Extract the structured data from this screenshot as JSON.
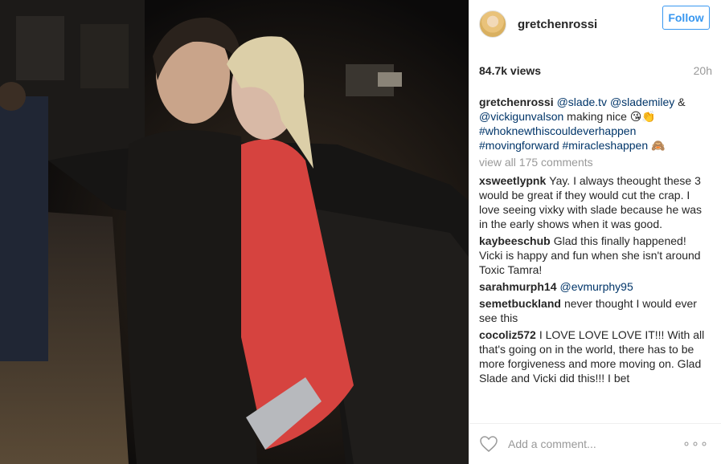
{
  "post": {
    "username": "gretchenrossi",
    "follow_label": "Follow",
    "views": "84.7k views",
    "time": "20h"
  },
  "caption": {
    "user": "gretchenrossi",
    "mention_1": "@slade.tv",
    "mention_2": "@slademiley",
    "amp": "&",
    "mention_3": "@vickigunvalson",
    "text": "making nice 😘👏",
    "tag_1": "#whoknewthiscouldeverhappen",
    "tag_2": "#movingforward",
    "tag_3": "#miracleshappen",
    "emoji": "🙈"
  },
  "view_all": "view all 175 comments",
  "comments": [
    {
      "user": "xsweetlypnk",
      "text": "Yay. I always theought these 3 would be great if they would cut the crap. I love seeing vixky with slade because he was in the early shows when it was good."
    },
    {
      "user": "kaybeeschub",
      "text": "Glad this finally happened! Vicki is happy and fun when she isn't around Toxic Tamra!"
    },
    {
      "user": "sarahmurph14",
      "text": "@evmurphy95"
    },
    {
      "user": "semetbuckland",
      "text": "never thought I would ever see this"
    },
    {
      "user": "cocoliz572",
      "text": "I LOVE LOVE LOVE IT!!! With all that's going on in the world, there has to be more forgiveness and more moving on. Glad Slade and Vicki did this!!! I bet"
    }
  ],
  "footer": {
    "add_comment_placeholder": "Add a comment...",
    "more": "∘∘∘"
  },
  "colors": {
    "accent": "#3897f0",
    "link": "#003569",
    "muted": "#999999",
    "text": "#262626"
  }
}
